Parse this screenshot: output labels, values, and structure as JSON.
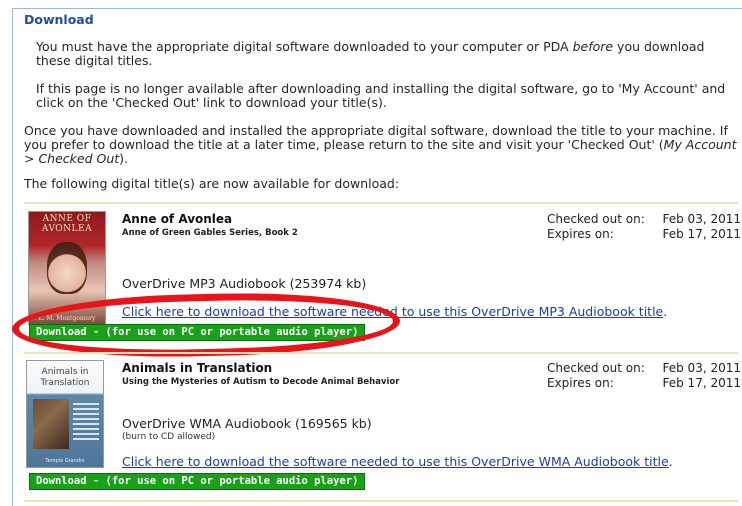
{
  "heading": "Download",
  "intro": {
    "p1_before": "You must have the appropriate digital software downloaded to your computer or PDA ",
    "p1_emph": "before",
    "p1_after": " you download these digital titles.",
    "p2": "If this page is no longer available after downloading and installing the digital software, go to 'My Account' and click on the 'Checked Out' link to download your title(s).",
    "p3_before": "Once you have downloaded and installed the appropriate digital software, download the title to your machine. If you prefer to download the title at a later time, please return to the site and visit your 'Checked Out' (",
    "p3_emph": "My Account > Checked Out",
    "p3_after": ").",
    "p4": "The following digital title(s) are now available for download:"
  },
  "titles": [
    {
      "cover_title": "ANNE OF AVONLEA",
      "cover_author": "L. M. Montgomery",
      "title": "Anne of Avonlea",
      "subtitle": "Anne of Green Gables Series, Book 2",
      "format": "OverDrive MP3 Audiobook (253974 kb)",
      "note": "",
      "software_link": "Click here to download the software needed to use this OverDrive MP3 Audiobook title",
      "link_suffix": ".",
      "checked_out_label": "Checked out on:",
      "checked_out": "Feb 03, 2011",
      "expires_label": "Expires on:",
      "expires": "Feb 17, 2011",
      "download_label": "Download - (for use on PC or portable audio player)"
    },
    {
      "cover_title": "Animals in Translation",
      "cover_author": "Temple Grandin",
      "title": "Animals in Translation",
      "subtitle": "Using the Mysteries of Autism to Decode Animal Behavior",
      "format": "OverDrive WMA Audiobook (169565 kb)",
      "note": "(burn to CD allowed)",
      "software_link": "Click here to download the software needed to use this OverDrive WMA Audiobook title",
      "link_suffix": ".",
      "checked_out_label": "Checked out on:",
      "checked_out": "Feb 03, 2011",
      "expires_label": "Expires on:",
      "expires": "Feb 17, 2011",
      "download_label": "Download - (for use on PC or portable audio player)"
    }
  ],
  "colors": {
    "heading": "#1d4f9c",
    "link": "#1a3fa8",
    "download_button": "#19a119",
    "annotation": "#e8141a"
  }
}
